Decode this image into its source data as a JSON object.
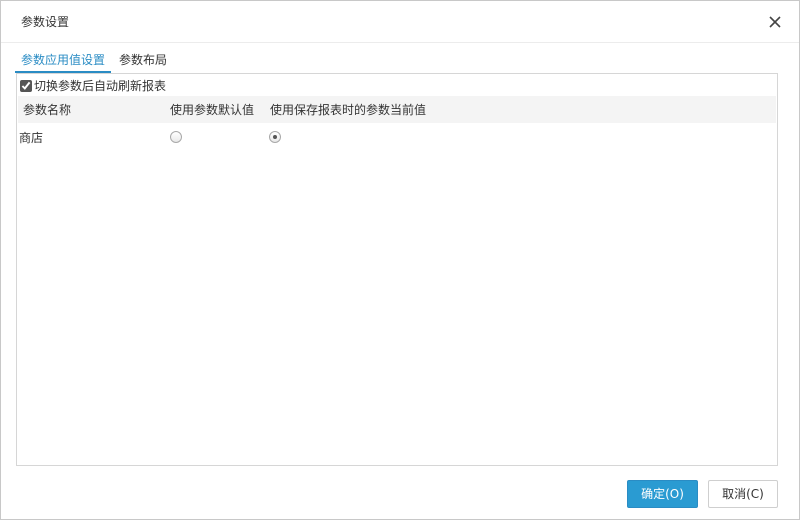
{
  "dialog": {
    "title": "参数设置",
    "close_icon": "close-icon"
  },
  "tabs": [
    {
      "label": "参数应用值设置",
      "active": true
    },
    {
      "label": "参数布局",
      "active": false
    }
  ],
  "options": {
    "auto_refresh_label": "切换参数后自动刷新报表",
    "auto_refresh_checked": true
  },
  "grid": {
    "columns": [
      "参数名称",
      "使用参数默认值",
      "使用保存报表时的参数当前值"
    ],
    "rows": [
      {
        "name": "商店",
        "use_default": false,
        "use_saved": true
      }
    ]
  },
  "buttons": {
    "ok_label": "确定(O)",
    "cancel_label": "取消(C)"
  },
  "colors": {
    "accent": "#2a9bd2",
    "tab_active": "#2a8cc4"
  }
}
